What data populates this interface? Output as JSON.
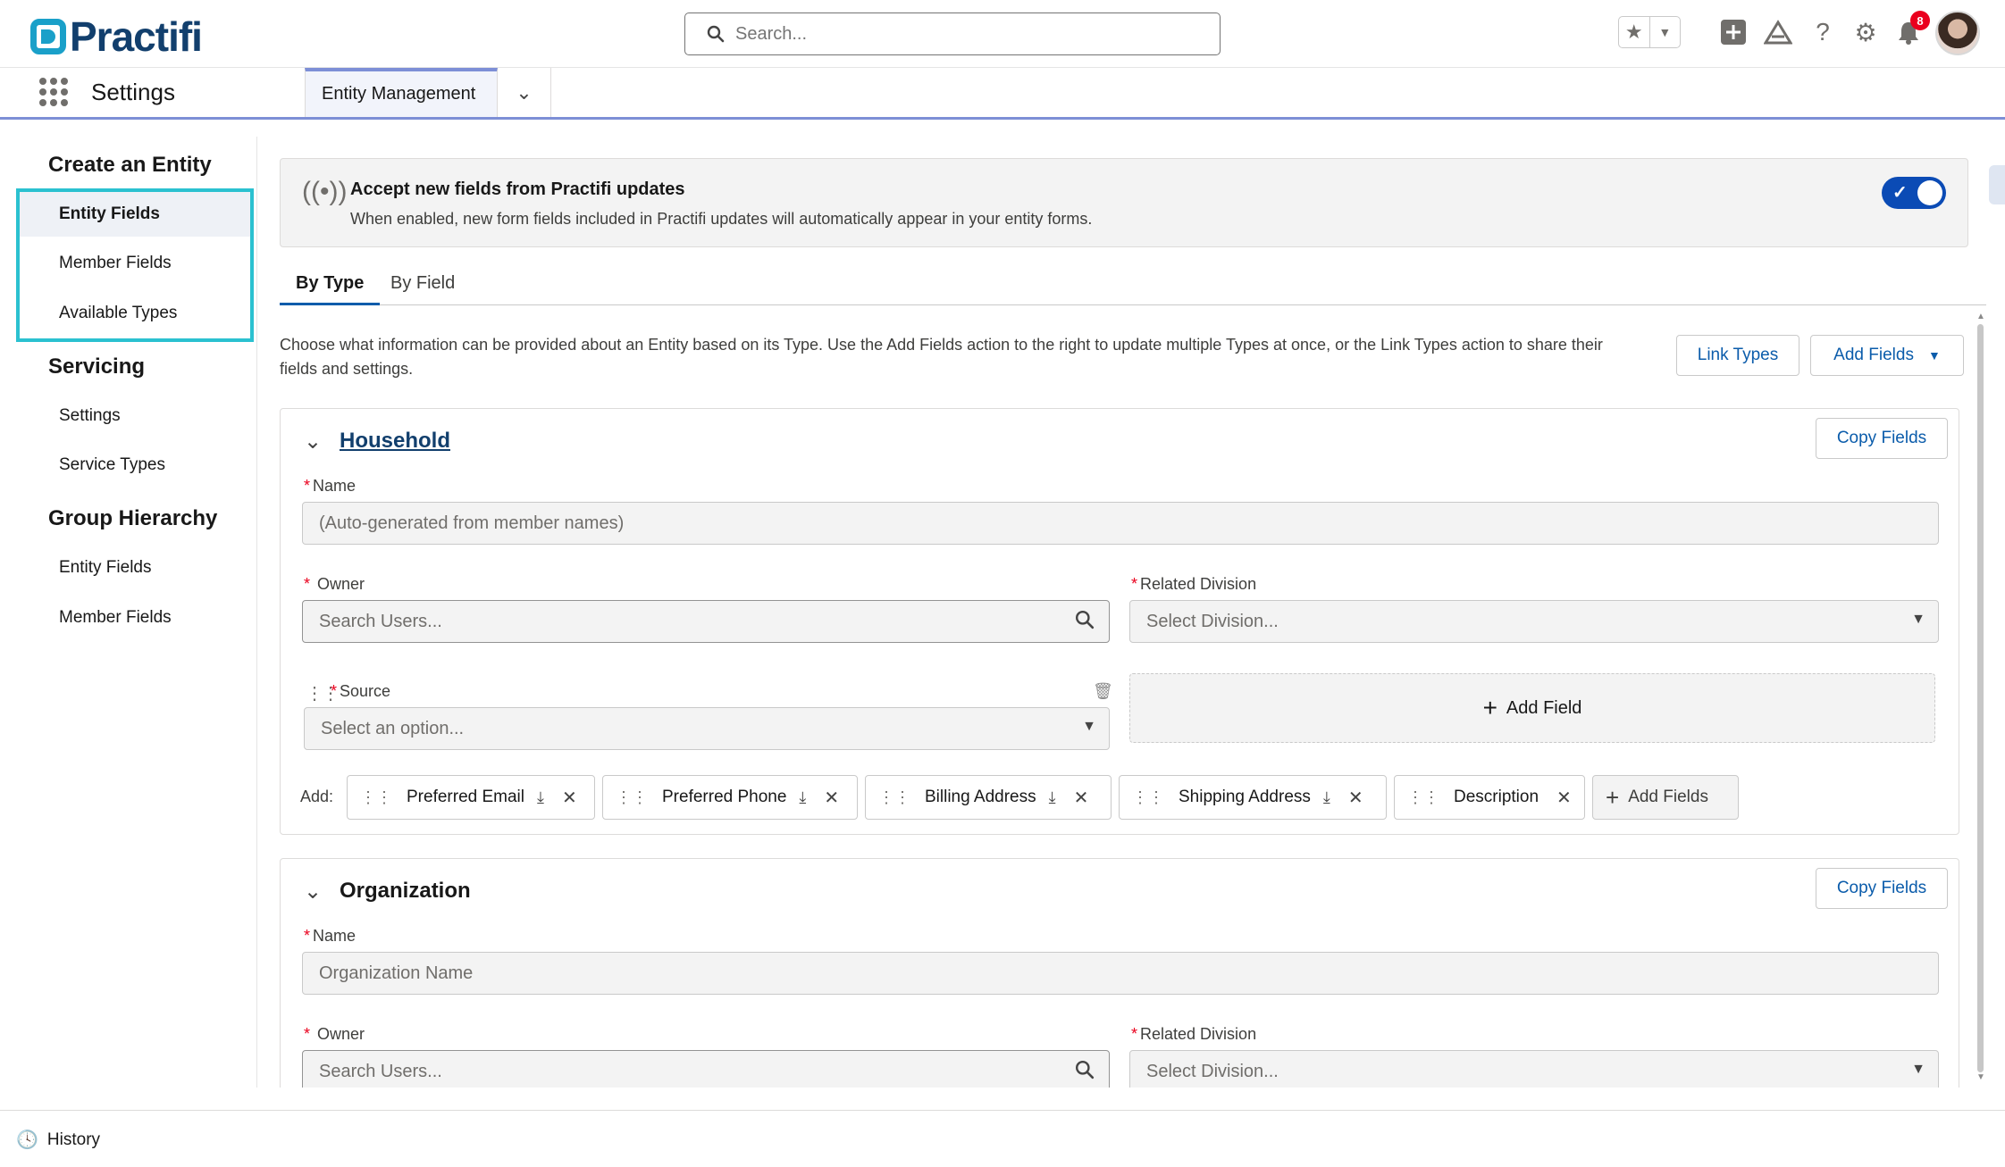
{
  "app": {
    "logo_text": "Practifi",
    "app_name": "Settings",
    "search_placeholder": "Search...",
    "notification_count": "8",
    "brand_color": "#123f6d",
    "accent_color": "#1aa0c9"
  },
  "nav": {
    "tab_label": "Entity Management"
  },
  "header_icons": {
    "favorite": "star-icon",
    "favorite_menu": "chevron-down-icon",
    "add": "plus-square-icon",
    "trailhead": "trailhead-icon",
    "help": "help-icon",
    "setup": "gear-icon",
    "notifications": "bell-icon"
  },
  "sidebar": {
    "groups": [
      {
        "title": "Create an Entity",
        "items": [
          "Entity Fields",
          "Member Fields",
          "Available Types"
        ]
      },
      {
        "title": "Servicing",
        "items": [
          "Settings",
          "Service Types"
        ]
      },
      {
        "title": "Group Hierarchy",
        "items": [
          "Entity Fields",
          "Member Fields"
        ]
      }
    ]
  },
  "notice": {
    "title": "Accept new fields from Practifi updates",
    "description": "When enabled, new form fields included in Practifi updates will automatically appear in your entity forms.",
    "toggle_on": true
  },
  "tabs": [
    "By Type",
    "By Field"
  ],
  "intro_text": "Choose what information can be provided about an Entity based on its Type. Use the Add Fields action to the right to update multiple Types at once, or the Link Types action to share their fields and settings.",
  "buttons": {
    "link_types": "Link Types",
    "add_fields": "Add Fields",
    "copy_fields": "Copy Fields",
    "add_field": "Add Field"
  },
  "household": {
    "title": "Household",
    "name_label": "Name",
    "name_placeholder": "(Auto-generated from member names)",
    "owner_label": "Owner",
    "owner_placeholder": "Search Users...",
    "division_label": "Related Division",
    "division_placeholder": "Select Division...",
    "source_label": "Source",
    "source_placeholder": "Select an option...",
    "add_label": "Add:",
    "available_fields": [
      "Preferred Email",
      "Preferred Phone",
      "Billing Address",
      "Shipping Address",
      "Description"
    ],
    "add_fields_label": "Add Fields"
  },
  "organization": {
    "title": "Organization",
    "name_label": "Name",
    "name_placeholder": "Organization Name",
    "owner_label": "Owner",
    "owner_placeholder": "Search Users...",
    "division_label": "Related Division",
    "division_placeholder": "Select Division..."
  },
  "footer": {
    "history_label": "History"
  }
}
